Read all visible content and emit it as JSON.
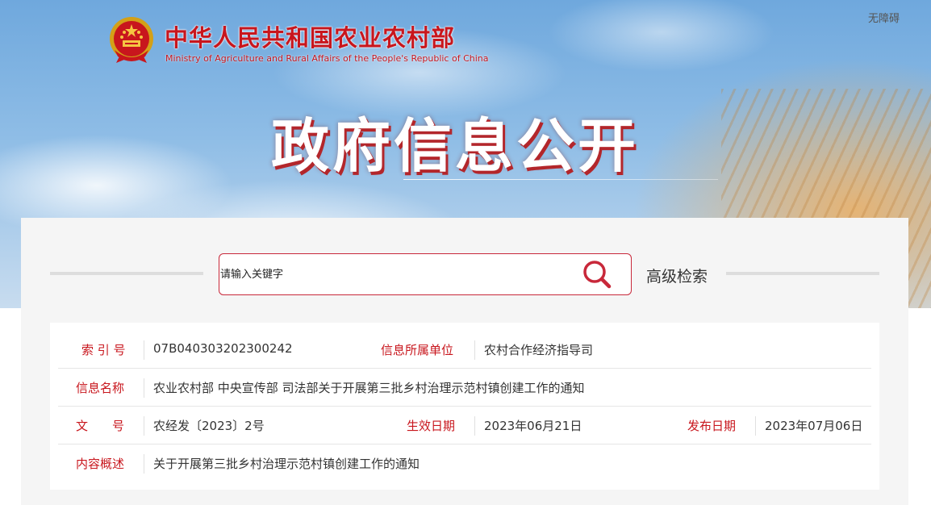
{
  "header": {
    "accessibility_label": "无障碍",
    "site_title_cn": "中华人民共和国农业农村部",
    "site_title_en": "Ministry of Agriculture and Rural Affairs of the People's Republic of China",
    "hero_title": "政府信息公开",
    "emblem_icon": "national-emblem-icon"
  },
  "search": {
    "placeholder": "请输入关键字",
    "search_icon": "search-icon",
    "advanced_label": "高级检索"
  },
  "info": {
    "index_label": "索 引 号",
    "index_value": "07B040303202300242",
    "unit_label": "信息所属单位",
    "unit_value": "农村合作经济指导司",
    "name_label": "信息名称",
    "name_value": "农业农村部 中央宣传部 司法部关于开展第三批乡村治理示范村镇创建工作的通知",
    "doc_label": "文　　号",
    "doc_value": "农经发〔2023〕2号",
    "effective_label": "生效日期",
    "effective_value": "2023年06月21日",
    "publish_label": "发布日期",
    "publish_value": "2023年07月06日",
    "summary_label": "内容概述",
    "summary_value": "关于开展第三批乡村治理示范村镇创建工作的通知"
  },
  "colors": {
    "accent_red": "#c8161d",
    "search_border": "#c8283a"
  }
}
